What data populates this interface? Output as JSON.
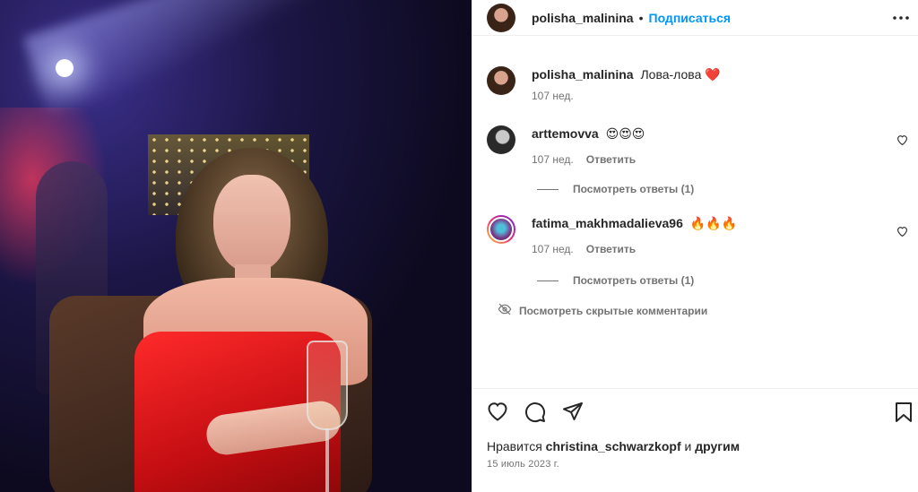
{
  "header": {
    "username": "polisha_malinina",
    "separator": "•",
    "follow_label": "Подписаться"
  },
  "caption": {
    "username": "polisha_malinina",
    "text": "Лова-лова",
    "emoji": "❤️",
    "time": "107 нед."
  },
  "comments": [
    {
      "username": "arttemovva",
      "text": "😍😍😍",
      "time": "107 нед.",
      "reply_label": "Ответить",
      "view_replies_label": "Посмотреть ответы (1)"
    },
    {
      "username": "fatima_makhmadalieva96",
      "text": "🔥🔥🔥",
      "time": "107 нед.",
      "reply_label": "Ответить",
      "view_replies_label": "Посмотреть ответы (1)"
    }
  ],
  "hidden_comments_label": "Посмотреть скрытые комментарии",
  "likes": {
    "prefix": "Нравится",
    "user": "christina_schwarzkopf",
    "suffix": "и другим"
  },
  "post_date": "15 июль 2023 г.",
  "icons": {
    "like": "heart-icon",
    "comment": "comment-icon",
    "share": "share-icon",
    "save": "bookmark-icon",
    "more": "more-icon",
    "hidden": "eye-off-icon"
  },
  "colors": {
    "accent": "#0095f6",
    "text": "#262626",
    "muted": "#737373",
    "dress": "#e3141a"
  }
}
